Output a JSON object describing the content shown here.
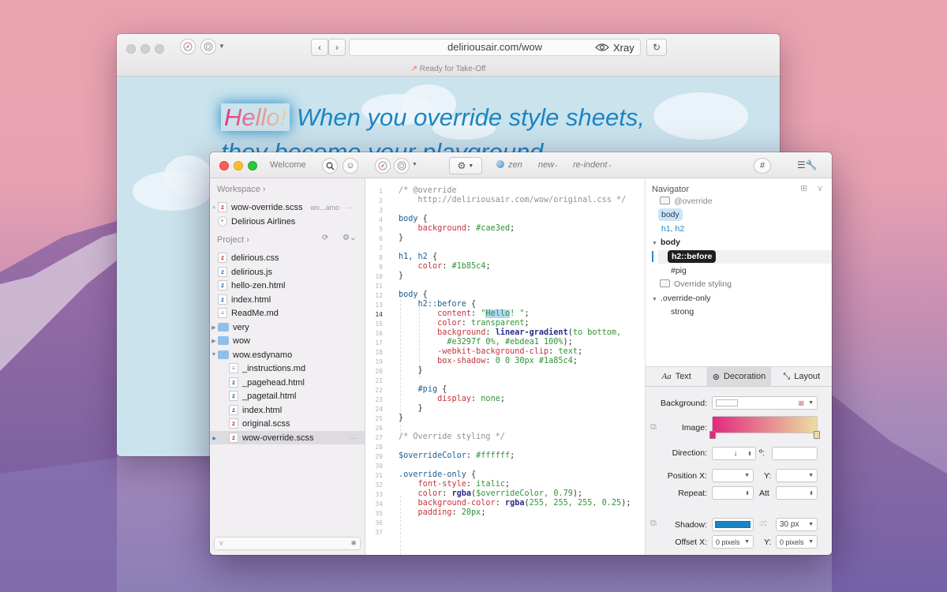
{
  "browser": {
    "url": "deliriousair.com/wow",
    "xray_label": "Xray",
    "status": "Ready for Take-Off",
    "headline_hello": "Hello!",
    "headline_line1": " When you override style sheets,",
    "headline_line2": "they become your playground"
  },
  "editor": {
    "title": "Welcome",
    "toolbar": {
      "zen_label": "zen",
      "new_label": "new",
      "reindent_label": "re-indent",
      "hash_label": "#"
    },
    "sidebar": {
      "workspace_label": "Workspace",
      "workspace_items": [
        {
          "name": "wow-override.scss",
          "detail": "wo...amo"
        },
        {
          "name": "Delirious Airlines",
          "detail": ""
        }
      ],
      "project_label": "Project",
      "project_items": [
        {
          "name": "delirious.css"
        },
        {
          "name": "delirious.js"
        },
        {
          "name": "hello-zen.html"
        },
        {
          "name": "index.html"
        },
        {
          "name": "ReadMe.md"
        },
        {
          "name": "very"
        },
        {
          "name": "wow"
        },
        {
          "name": "wow.esdynamo"
        },
        {
          "name": "_instructions.md"
        },
        {
          "name": "_pagehead.html"
        },
        {
          "name": "_pagetail.html"
        },
        {
          "name": "index.html"
        },
        {
          "name": "original.scss"
        },
        {
          "name": "wow-override.scss"
        }
      ]
    },
    "code_lines": [
      "1",
      "2",
      "3",
      "4",
      "5",
      "6",
      "7",
      "8",
      "9",
      "10",
      "11",
      "12",
      "13",
      "14",
      "15",
      "16",
      "17",
      "18",
      "19",
      "20",
      "21",
      "22",
      "23",
      "24",
      "25",
      "26",
      "27",
      "28",
      "29",
      "30",
      "31",
      "32",
      "33",
      "34",
      "35",
      "36",
      "37"
    ],
    "navigator": {
      "title": "Navigator",
      "items": [
        "@override",
        "body",
        "h1, h2",
        "body",
        "h2::before",
        "#pig",
        "Override styling",
        ".override-only",
        "strong"
      ]
    },
    "inspector": {
      "tabs": [
        "Text",
        "Decoration",
        "Layout"
      ],
      "background_label": "Background:",
      "image_label": "Image:",
      "direction_label": "Direction:",
      "direction_value": "↓",
      "degree_symbol": "º:",
      "position_x_label": "Position X:",
      "y_label": "Y:",
      "repeat_label": "Repeat:",
      "att_label": "Att",
      "shadow_label": "Shadow:",
      "shadow_blur": "30 px",
      "offset_x_label": "Offset X:",
      "offset_x_value": "0 pixels",
      "offset_y_value": "0 pixels",
      "shadow_color": "#1a85c4",
      "gradient_start": "#e3297f",
      "gradient_end": "#ebdea1"
    }
  }
}
